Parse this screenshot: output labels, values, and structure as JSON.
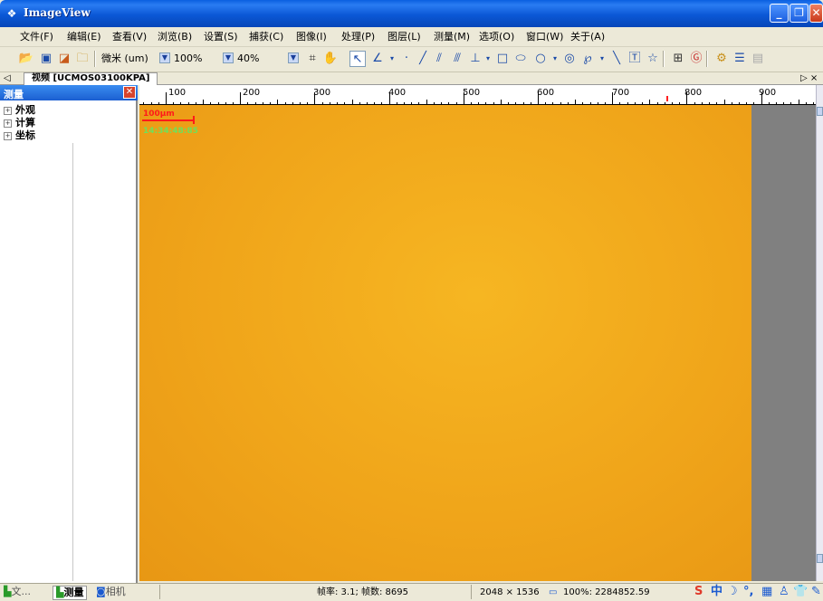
{
  "window": {
    "title": "ImageView"
  },
  "menu": [
    "文件(F)",
    "编辑(E)",
    "查看(V)",
    "浏览(B)",
    "设置(S)",
    "捕获(C)",
    "图像(I)",
    "处理(P)",
    "图层(L)",
    "测量(M)",
    "选项(O)",
    "窗口(W)",
    "关于(A)"
  ],
  "toolbar": {
    "unit": "微米 (um)",
    "zoom": "100%",
    "opacity": "40%"
  },
  "tab": {
    "label": "视频 [UCMOS03100KPA]",
    "left_arrow": "◁",
    "right_controls": "▷ ×"
  },
  "panel": {
    "title": "测量",
    "items": [
      "外观",
      "计算",
      "坐标"
    ]
  },
  "ruler": {
    "labels": [
      "100",
      "200",
      "300",
      "400",
      "500",
      "600",
      "700",
      "800",
      "900"
    ]
  },
  "overlay": {
    "scale_text": "100μm",
    "timestamp": "14:34:48:85"
  },
  "bottom_tabs": [
    "文...",
    "测量",
    "相机"
  ],
  "status": {
    "fps": "帧率: 3.1; 帧数: 8695",
    "resolution": "2048 × 1536",
    "zoom_coords": "100%: 2284852.59"
  },
  "tray": {
    "ime_logo": "S",
    "ime_mode": "中"
  }
}
